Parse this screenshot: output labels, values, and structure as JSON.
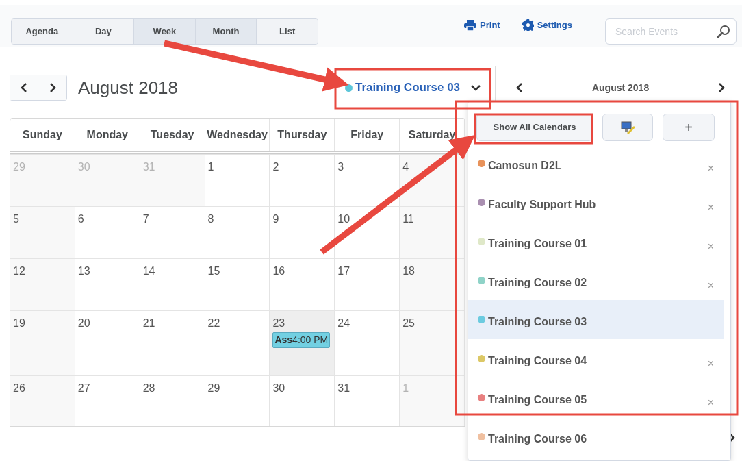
{
  "view_tabs": [
    {
      "label": "Agenda",
      "selected": false
    },
    {
      "label": "Day",
      "selected": false
    },
    {
      "label": "Week",
      "selected": true
    },
    {
      "label": "Month",
      "selected": true
    },
    {
      "label": "List",
      "selected": false
    }
  ],
  "toolbar": {
    "print": "Print",
    "settings": "Settings"
  },
  "search": {
    "placeholder": "Search Events"
  },
  "month_title": "August 2018",
  "calendar_select": {
    "label": "Training Course 03",
    "color": "#5cc6d9"
  },
  "mini_calendar": {
    "month": "August 2018"
  },
  "calendar": {
    "weekdays": [
      "Sunday",
      "Monday",
      "Tuesday",
      "Wednesday",
      "Thursday",
      "Friday",
      "Saturday"
    ],
    "weeks": [
      [
        {
          "day": "29",
          "other_month": true
        },
        {
          "day": "30",
          "other_month": true
        },
        {
          "day": "31",
          "other_month": true
        },
        {
          "day": "1"
        },
        {
          "day": "2"
        },
        {
          "day": "3"
        },
        {
          "day": "4"
        }
      ],
      [
        {
          "day": "5"
        },
        {
          "day": "6"
        },
        {
          "day": "7"
        },
        {
          "day": "8"
        },
        {
          "day": "9"
        },
        {
          "day": "10"
        },
        {
          "day": "11"
        }
      ],
      [
        {
          "day": "12"
        },
        {
          "day": "13"
        },
        {
          "day": "14"
        },
        {
          "day": "15"
        },
        {
          "day": "16"
        },
        {
          "day": "17"
        },
        {
          "day": "18"
        }
      ],
      [
        {
          "day": "19"
        },
        {
          "day": "20"
        },
        {
          "day": "21"
        },
        {
          "day": "22"
        },
        {
          "day": "23",
          "today": true,
          "events": [
            {
              "title": "Ass",
              "time": "4:00 PM",
              "color": "#72d0e2"
            }
          ]
        },
        {
          "day": "24"
        },
        {
          "day": "25"
        }
      ],
      [
        {
          "day": "26"
        },
        {
          "day": "27"
        },
        {
          "day": "28"
        },
        {
          "day": "29"
        },
        {
          "day": "30"
        },
        {
          "day": "31"
        },
        {
          "day": "1",
          "other_month": true
        }
      ]
    ]
  },
  "dropdown": {
    "show_all": "Show All Calendars",
    "add": "+",
    "calendars": [
      {
        "name": "Camosun D2L",
        "color": "#e8925a",
        "selected": false,
        "remove": "×"
      },
      {
        "name": "Faculty Support Hub",
        "color": "#a98fb0",
        "selected": false,
        "remove": "×"
      },
      {
        "name": "Training Course 01",
        "color": "#dfe8c8",
        "selected": false,
        "remove": "×"
      },
      {
        "name": "Training Course 02",
        "color": "#8fd3c8",
        "selected": false,
        "remove": "×"
      },
      {
        "name": "Training Course 03",
        "color": "#6ccbe0",
        "selected": true
      },
      {
        "name": "Training Course 04",
        "color": "#dcc866",
        "selected": false,
        "remove": "×"
      },
      {
        "name": "Training Course 05",
        "color": "#e88080",
        "selected": false,
        "remove": "×"
      },
      {
        "name": "Training Course 06",
        "color": "#f0c0a0",
        "selected": false
      }
    ]
  }
}
